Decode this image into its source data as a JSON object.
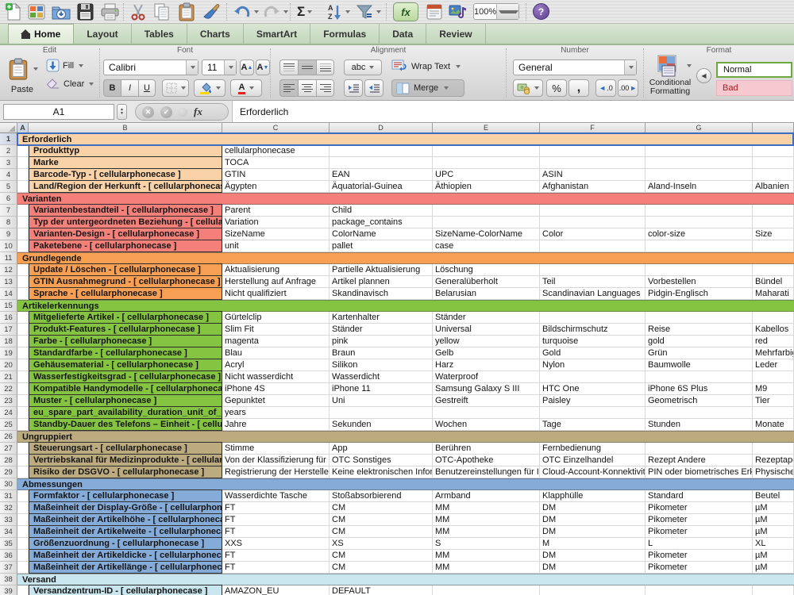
{
  "toolbar": {
    "autosum": "Σ",
    "sort_a": "A",
    "sort_z": "Z",
    "fx": "fx",
    "zoom": "100%",
    "help": "?",
    "icons": [
      "new-document",
      "show-gallery",
      "open",
      "save",
      "print",
      "cut",
      "copy",
      "paste",
      "format-painter",
      "undo",
      "redo",
      "autosum",
      "sort",
      "filter",
      "formula-builder",
      "toolbox",
      "media-browser",
      "zoom-control",
      "help"
    ]
  },
  "tabs": [
    {
      "label": "Home",
      "active": true
    },
    {
      "label": "Layout",
      "active": false
    },
    {
      "label": "Tables",
      "active": false
    },
    {
      "label": "Charts",
      "active": false
    },
    {
      "label": "SmartArt",
      "active": false
    },
    {
      "label": "Formulas",
      "active": false
    },
    {
      "label": "Data",
      "active": false
    },
    {
      "label": "Review",
      "active": false
    }
  ],
  "ribbon": {
    "group_labels": {
      "edit": "Edit",
      "font": "Font",
      "alignment": "Alignment",
      "number": "Number",
      "format": "Format"
    },
    "edit": {
      "paste": "Paste",
      "fill": "Fill",
      "clear": "Clear"
    },
    "font": {
      "name": "Calibri",
      "size": "11",
      "bold": "B",
      "italic": "I",
      "underline": "U",
      "grow": "A",
      "shrink": "A",
      "color": "A"
    },
    "alignment": {
      "abc": "abc",
      "wrap_text": "Wrap Text",
      "merge": "Merge"
    },
    "number": {
      "format": "General",
      "percent": "%",
      "comma": ",",
      "dec_left": ".0",
      "dec_right": ".00"
    },
    "format": {
      "conditional_line1": "Conditional",
      "conditional_line2": "Formatting",
      "styles": [
        {
          "label": "Normal",
          "kind": "normal"
        },
        {
          "label": "Bad",
          "kind": "bad"
        }
      ]
    }
  },
  "formula_bar": {
    "name_box": "A1",
    "fx": "fx",
    "cancel": "✕",
    "accept": "✓",
    "content": "Erforderlich"
  },
  "colors": {
    "selection": "#3D6DC1",
    "sections": {
      "peach": "#F9D2A7",
      "salmon": "#F5807A",
      "orange": "#F7A054",
      "green": "#84C441",
      "tan": "#BCAB7E",
      "blue": "#85ABD8",
      "cyan": "#C9E6EF"
    },
    "style_normal_border": "#6FA83F",
    "style_bad_bg": "#F6C9D0",
    "style_bad_text": "#A31F24"
  },
  "sheet": {
    "column_headers": [
      "A",
      "B",
      "C",
      "D",
      "E",
      "F",
      "G",
      ""
    ],
    "selected_cell": "A1",
    "rows": [
      {
        "num": 1,
        "kind": "section",
        "theme": "peach",
        "label": "Erforderlich",
        "selected": true
      },
      {
        "num": 2,
        "kind": "item",
        "theme": "peach",
        "label": "Produkttyp",
        "values": [
          "cellularphonecase",
          "",
          "",
          "",
          "",
          ""
        ]
      },
      {
        "num": 3,
        "kind": "item",
        "theme": "peach",
        "label": "Marke",
        "values": [
          "TOCA",
          "",
          "",
          "",
          "",
          ""
        ]
      },
      {
        "num": 4,
        "kind": "item",
        "theme": "peach",
        "label": "Barcode-Typ - [ cellularphonecase ]",
        "values": [
          "GTIN",
          "EAN",
          "UPC",
          "ASIN",
          "",
          ""
        ]
      },
      {
        "num": 5,
        "kind": "item",
        "theme": "peach",
        "label": "Land/Region der Herkunft - [ cellularphonecase ]",
        "values": [
          "Ägypten",
          "Äquatorial-Guinea",
          "Äthiopien",
          "Afghanistan",
          "Aland-Inseln",
          "Albanien"
        ]
      },
      {
        "num": 6,
        "kind": "section",
        "theme": "salmon",
        "label": "Varianten"
      },
      {
        "num": 7,
        "kind": "item",
        "theme": "salmon",
        "label": "Variantenbestandteil - [ cellularphonecase ]",
        "values": [
          "Parent",
          "Child",
          "",
          "",
          "",
          ""
        ]
      },
      {
        "num": 8,
        "kind": "item",
        "theme": "salmon",
        "label": "Typ der untergeordneten Beziehung - [ cellularphonecase ]",
        "values": [
          "Variation",
          "package_contains",
          "",
          "",
          "",
          ""
        ]
      },
      {
        "num": 9,
        "kind": "item",
        "theme": "salmon",
        "label": "Varianten-Design - [ cellularphonecase ]",
        "values": [
          "SizeName",
          "ColorName",
          "SizeName-ColorName",
          "Color",
          "color-size",
          "Size"
        ]
      },
      {
        "num": 10,
        "kind": "item",
        "theme": "salmon",
        "label": "Paketebene - [ cellularphonecase ]",
        "values": [
          "unit",
          "pallet",
          "case",
          "",
          "",
          ""
        ]
      },
      {
        "num": 11,
        "kind": "section",
        "theme": "orange",
        "label": "Grundlegende"
      },
      {
        "num": 12,
        "kind": "item",
        "theme": "orange",
        "label": "Update / Löschen - [ cellularphonecase ]",
        "values": [
          "Aktualisierung",
          "Partielle Aktualisierung",
          "Löschung",
          "",
          "",
          ""
        ]
      },
      {
        "num": 13,
        "kind": "item",
        "theme": "orange",
        "label": "GTIN Ausnahmegrund - [ cellularphonecase ]",
        "values": [
          "Herstellung auf Anfrage",
          "Artikel plannen",
          "Generalüberholt",
          "Teil",
          "Vorbestellen",
          "Bündel"
        ]
      },
      {
        "num": 14,
        "kind": "item",
        "theme": "orange",
        "label": "Sprache - [ cellularphonecase ]",
        "values": [
          "Nicht qualifiziert",
          "Skandinavisch",
          "Belarusian",
          "Scandinavian Languages",
          "Pidgin-Englisch",
          "Maharati"
        ]
      },
      {
        "num": 15,
        "kind": "section",
        "theme": "green",
        "label": "Artikelerkennungs"
      },
      {
        "num": 16,
        "kind": "item",
        "theme": "green",
        "label": "Mitgelieferte Artikel - [ cellularphonecase ]",
        "values": [
          "Gürtelclip",
          "Kartenhalter",
          "Ständer",
          "",
          "",
          ""
        ]
      },
      {
        "num": 17,
        "kind": "item",
        "theme": "green",
        "label": "Produkt-Features - [ cellularphonecase ]",
        "values": [
          "Slim Fit",
          "Ständer",
          "Universal",
          "Bildschirmschutz",
          "Reise",
          "Kabellos"
        ]
      },
      {
        "num": 18,
        "kind": "item",
        "theme": "green",
        "label": "Farbe - [ cellularphonecase ]",
        "values": [
          "magenta",
          "pink",
          "yellow",
          "turquoise",
          "gold",
          "red"
        ]
      },
      {
        "num": 19,
        "kind": "item",
        "theme": "green",
        "label": "Standardfarbe - [ cellularphonecase ]",
        "values": [
          "Blau",
          "Braun",
          "Gelb",
          "Gold",
          "Grün",
          "Mehrfarbig"
        ]
      },
      {
        "num": 20,
        "kind": "item",
        "theme": "green",
        "label": "Gehäusematerial - [ cellularphonecase ]",
        "values": [
          "Acryl",
          "Silikon",
          "Harz",
          "Nylon",
          "Baumwolle",
          "Leder"
        ]
      },
      {
        "num": 21,
        "kind": "item",
        "theme": "green",
        "label": "Wasserfestigkeitsgrad - [ cellularphonecase ]",
        "values": [
          "Nicht wasserdicht",
          "Wasserdicht",
          "Waterproof",
          "",
          "",
          ""
        ]
      },
      {
        "num": 22,
        "kind": "item",
        "theme": "green",
        "label": "Kompatible Handymodelle - [ cellularphonecase ]",
        "values": [
          "iPhone 4S",
          "iPhone 11",
          "Samsung Galaxy S III",
          "HTC One",
          "iPhone 6S Plus",
          "M9"
        ]
      },
      {
        "num": 23,
        "kind": "item",
        "theme": "green",
        "label": "Muster - [ cellularphonecase ]",
        "values": [
          "Gepunktet",
          "Uni",
          "Gestreift",
          "Paisley",
          "Geometrisch",
          "Tier"
        ]
      },
      {
        "num": 24,
        "kind": "item",
        "theme": "green",
        "label": "eu_spare_part_availability_duration_unit_of_measure",
        "values": [
          "years",
          "",
          "",
          "",
          "",
          ""
        ]
      },
      {
        "num": 25,
        "kind": "item",
        "theme": "green",
        "label": "Standby-Dauer des Telefons – Einheit - [ cellularphonecase ]",
        "values": [
          "Jahre",
          "Sekunden",
          "Wochen",
          "Tage",
          "Stunden",
          "Monate"
        ]
      },
      {
        "num": 26,
        "kind": "section",
        "theme": "tan",
        "label": "Ungruppiert"
      },
      {
        "num": 27,
        "kind": "item",
        "theme": "tan",
        "label": "Steuerungsart - [ cellularphonecase ]",
        "values": [
          "Stimme",
          "App",
          "Berühren",
          "Fernbedienung",
          "",
          ""
        ]
      },
      {
        "num": 28,
        "kind": "item",
        "theme": "tan",
        "label": "Vertriebskanal für Medizinprodukte - [ cellularphonecase ]",
        "values": [
          "Von der Klassifizierung für Medizinprodukte",
          "OTC Sonstiges",
          "OTC-Apotheke",
          "OTC Einzelhandel",
          "Rezept Andere",
          "Rezeptapotheke"
        ]
      },
      {
        "num": 29,
        "kind": "item",
        "theme": "tan",
        "label": "Risiko der DSGVO - [ cellularphonecase ]",
        "values": [
          "Registrierung der Hersteller",
          "Keine elektronischen Informationen",
          "Benutzereinstellungen für Informationen",
          "Cloud-Account-Konnektivität",
          "PIN oder biometrisches Erkennungssystem",
          "Physische Sicherung"
        ]
      },
      {
        "num": 30,
        "kind": "section",
        "theme": "blue",
        "label": "Abmessungen"
      },
      {
        "num": 31,
        "kind": "item",
        "theme": "blue",
        "label": "Formfaktor - [ cellularphonecase ]",
        "values": [
          "Wasserdichte Tasche",
          "Stoßabsorbierend",
          "Armband",
          "Klapphülle",
          "Standard",
          "Beutel"
        ]
      },
      {
        "num": 32,
        "kind": "item",
        "theme": "blue",
        "label": "Maßeinheit der Display-Größe - [ cellularphonecase ]",
        "values": [
          "FT",
          "CM",
          "MM",
          "DM",
          "Pikometer",
          "µM"
        ]
      },
      {
        "num": 33,
        "kind": "item",
        "theme": "blue",
        "label": "Maßeinheit der Artikelhöhe - [ cellularphonecase ]",
        "values": [
          "FT",
          "CM",
          "MM",
          "DM",
          "Pikometer",
          "µM"
        ]
      },
      {
        "num": 34,
        "kind": "item",
        "theme": "blue",
        "label": "Maßeinheit der Artikelweite - [ cellularphonecase ]",
        "values": [
          "FT",
          "CM",
          "MM",
          "DM",
          "Pikometer",
          "µM"
        ]
      },
      {
        "num": 35,
        "kind": "item",
        "theme": "blue",
        "label": "Größenzuordnung - [ cellularphonecase ]",
        "values": [
          "XXS",
          "XS",
          "S",
          "M",
          "L",
          "XL"
        ]
      },
      {
        "num": 36,
        "kind": "item",
        "theme": "blue",
        "label": "Maßeinheit der Artikeldicke - [ cellularphonecase ]",
        "values": [
          "FT",
          "CM",
          "MM",
          "DM",
          "Pikometer",
          "µM"
        ]
      },
      {
        "num": 37,
        "kind": "item",
        "theme": "blue",
        "label": "Maßeinheit der Artikellänge - [ cellularphonecase ]",
        "values": [
          "FT",
          "CM",
          "MM",
          "DM",
          "Pikometer",
          "µM"
        ]
      },
      {
        "num": 38,
        "kind": "section",
        "theme": "cyan",
        "label": "Versand"
      },
      {
        "num": 39,
        "kind": "item",
        "theme": "cyan",
        "label": "Versandzentrum-ID - [ cellularphonecase ]",
        "values": [
          "AMAZON_EU",
          "DEFAULT",
          "",
          "",
          "",
          ""
        ]
      }
    ]
  }
}
